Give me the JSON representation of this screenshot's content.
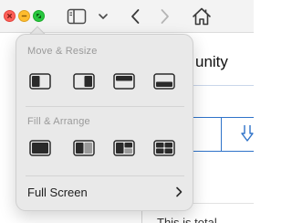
{
  "toolbar": {
    "icons": [
      "close-icon",
      "minimize-icon",
      "zoom-icon",
      "sidebar-icon",
      "chevron-down-icon",
      "back-icon",
      "forward-icon",
      "home-icon"
    ]
  },
  "page": {
    "heading_fragment": "unity",
    "cell_fragment": ")",
    "bottom_fragment": "This is total"
  },
  "menu": {
    "move_resize_title": "Move & Resize",
    "fill_arrange_title": "Fill & Arrange",
    "full_screen_label": "Full Screen",
    "move_resize_icons": [
      "tile-left-half-icon",
      "tile-right-half-icon",
      "tile-top-half-icon",
      "tile-bottom-half-icon"
    ],
    "fill_arrange_icons": [
      "fill-screen-icon",
      "split-left-right-icon",
      "split-three-icon",
      "split-quarters-icon"
    ]
  },
  "colors": {
    "close": "#ff5f57",
    "minimize": "#febc2e",
    "zoom": "#28c840",
    "link_blue": "#2f73c9"
  }
}
